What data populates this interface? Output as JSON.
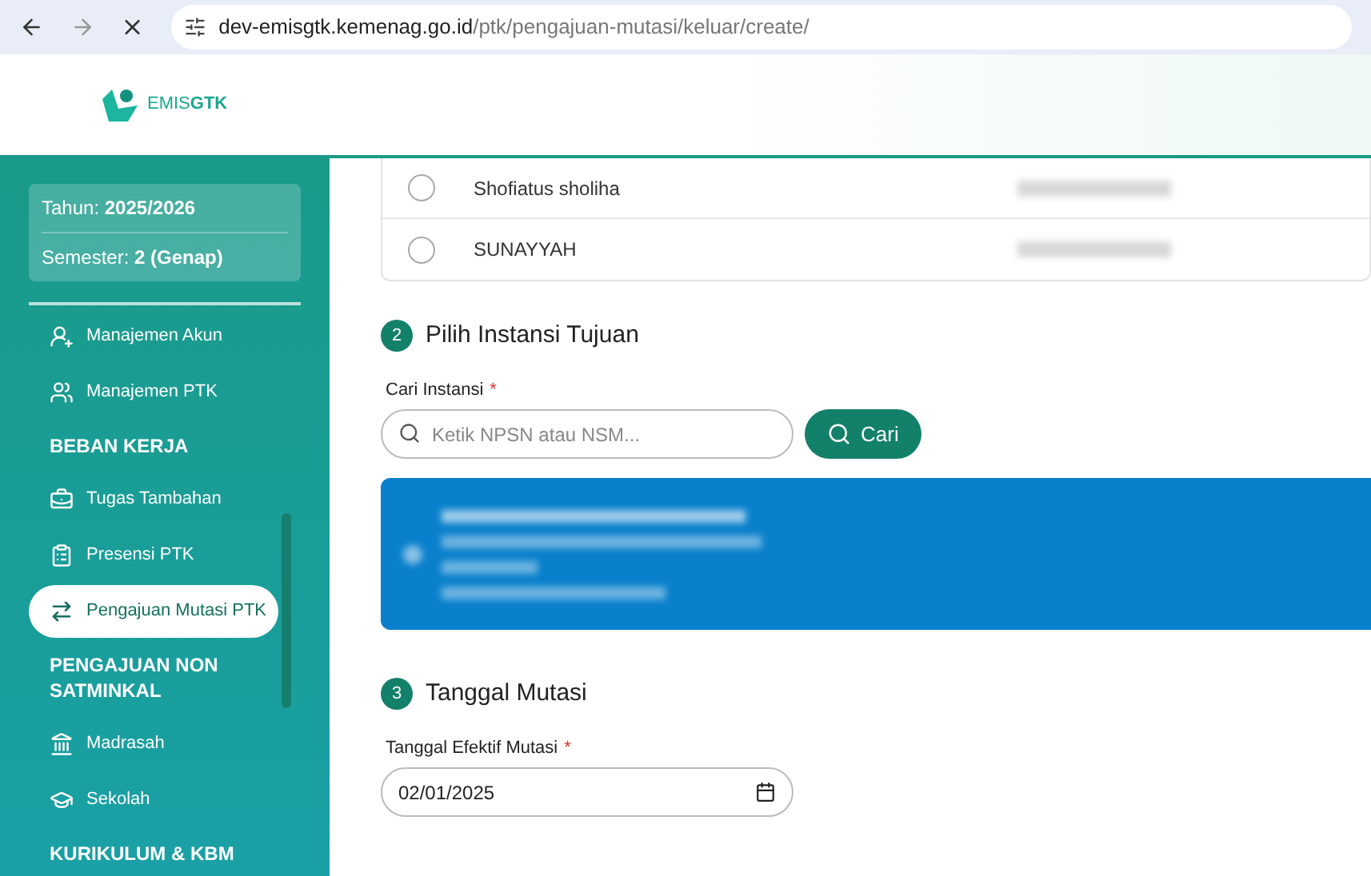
{
  "browser": {
    "url_host": "dev-emisgtk.kemenag.go.id",
    "url_path": "/ptk/pengajuan-mutasi/keluar/create/"
  },
  "header": {
    "logo_text_light": "EMIS",
    "logo_text_bold": "GTK"
  },
  "sidebar": {
    "period": [
      {
        "label": "Tahun:",
        "value": "2025/2026"
      },
      {
        "label": "Semester:",
        "value": "2 (Genap)"
      }
    ],
    "items": [
      {
        "kind": "link",
        "label": "Manajemen Akun",
        "selected": false
      },
      {
        "kind": "link",
        "label": "Manajemen PTK",
        "selected": false
      },
      {
        "kind": "heading",
        "label": "BEBAN KERJA"
      },
      {
        "kind": "link",
        "label": "Tugas Tambahan",
        "selected": false
      },
      {
        "kind": "link",
        "label": "Presensi PTK",
        "selected": false
      },
      {
        "kind": "link",
        "label": "Pengajuan Mutasi PTK",
        "selected": true
      },
      {
        "kind": "heading",
        "label": "PENGAJUAN NON SATMINKAL"
      },
      {
        "kind": "link",
        "label": "Madrasah",
        "selected": false
      },
      {
        "kind": "link",
        "label": "Sekolah",
        "selected": false
      },
      {
        "kind": "heading",
        "label": "KURIKULUM & KBM"
      }
    ]
  },
  "ptk_list": [
    {
      "name": "Shofiatus sholiha",
      "selected": false
    },
    {
      "name": "SUNAYYAH",
      "selected": false
    }
  ],
  "step2": {
    "number": "2",
    "title": "Pilih Instansi Tujuan",
    "field_label": "Cari Instansi",
    "required_mark": "*",
    "placeholder": "Ketik NPSN atau NSM...",
    "button": "Cari"
  },
  "step3": {
    "number": "3",
    "title": "Tanggal Mutasi",
    "field_label": "Tanggal Efektif Mutasi",
    "required_mark": "*",
    "value": "02/01/2025"
  }
}
